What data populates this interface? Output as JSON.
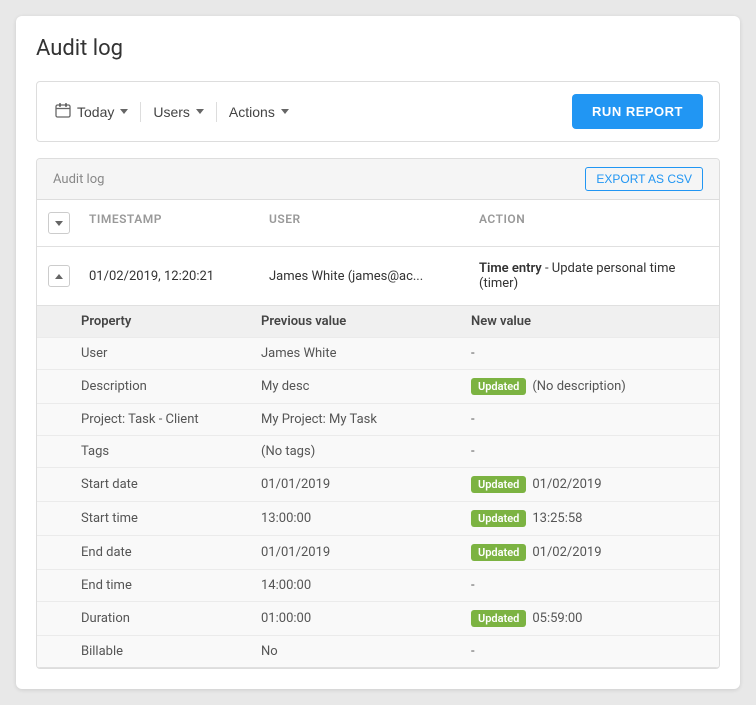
{
  "page": {
    "title": "Audit log"
  },
  "filters": {
    "date_label": "Today",
    "date_icon": "calendar",
    "users_label": "Users",
    "actions_label": "Actions",
    "run_report_label": "RUN REPORT"
  },
  "table": {
    "section_label": "Audit log",
    "export_label": "EXPORT AS CSV",
    "columns": {
      "timestamp": "TIMESTAMP",
      "user": "USER",
      "action": "ACTION"
    }
  },
  "log_entry": {
    "timestamp": "01/02/2019, 12:20:21",
    "user": "James White (james@ac...",
    "action_entry": "Time entry",
    "action_desc": " - Update personal time (timer)"
  },
  "detail_headers": {
    "property": "Property",
    "previous": "Previous value",
    "new": "New value"
  },
  "detail_rows": [
    {
      "property": "User",
      "previous": "James White",
      "new_value": "-",
      "updated": false
    },
    {
      "property": "Description",
      "previous": "My desc",
      "new_value": "(No description)",
      "updated": true
    },
    {
      "property": "Project: Task - Client",
      "previous": "My Project: My Task",
      "new_value": "-",
      "updated": false
    },
    {
      "property": "Tags",
      "previous": "(No tags)",
      "new_value": "-",
      "updated": false
    },
    {
      "property": "Start date",
      "previous": "01/01/2019",
      "new_value": "01/02/2019",
      "updated": true
    },
    {
      "property": "Start time",
      "previous": "13:00:00",
      "new_value": "13:25:58",
      "updated": true
    },
    {
      "property": "End date",
      "previous": "01/01/2019",
      "new_value": "01/02/2019",
      "updated": true
    },
    {
      "property": "End time",
      "previous": "14:00:00",
      "new_value": "-",
      "updated": false
    },
    {
      "property": "Duration",
      "previous": "01:00:00",
      "new_value": "05:59:00",
      "updated": true
    },
    {
      "property": "Billable",
      "previous": "No",
      "new_value": "-",
      "updated": false
    }
  ],
  "badge": {
    "label": "Updated"
  }
}
